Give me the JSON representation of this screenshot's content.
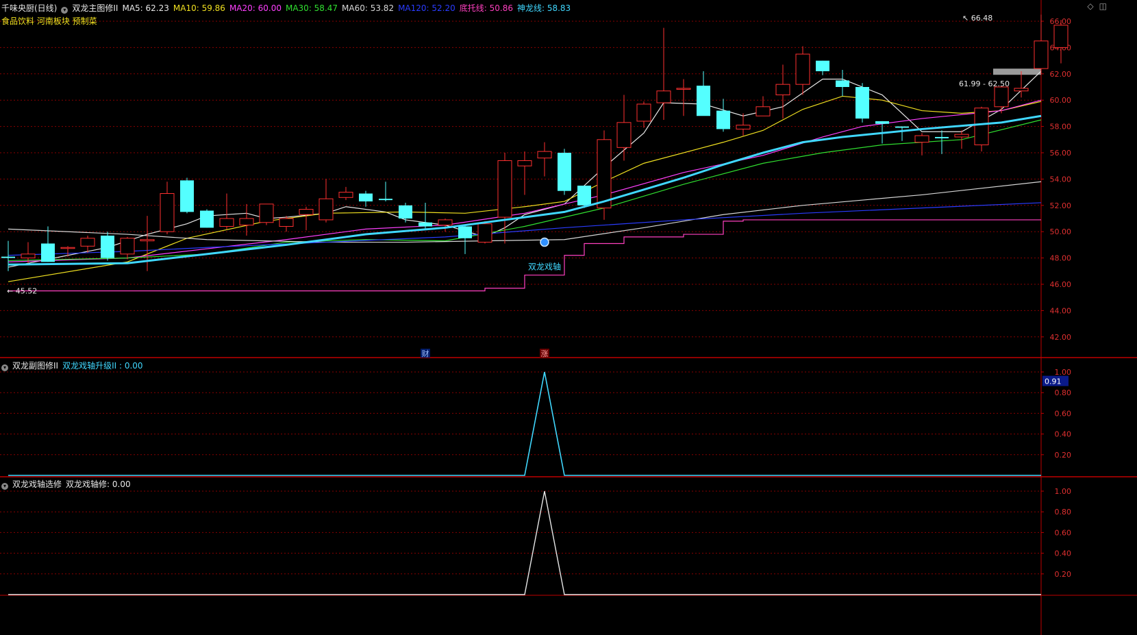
{
  "header": {
    "title": "千味央厨(日线)",
    "indicator": "双龙主图修II",
    "ma": [
      {
        "label": "MA5: 62.23",
        "color": "#e8e8e8"
      },
      {
        "label": "MA10: 59.86",
        "color": "#f0e020"
      },
      {
        "label": "MA20: 60.00",
        "color": "#ff40ff"
      },
      {
        "label": "MA30: 58.47",
        "color": "#30e030"
      },
      {
        "label": "MA60: 53.82",
        "color": "#d8d8d8"
      },
      {
        "label": "MA120: 52.20",
        "color": "#2a3cff"
      },
      {
        "label": "底托线: 50.86",
        "color": "#ff40c0"
      },
      {
        "label": "神龙线: 58.83",
        "color": "#40d8ff"
      }
    ],
    "tags": "食品饮料 河南板块 预制菜"
  },
  "panel2": {
    "title": "双龙副图修II",
    "label": "双龙戏轴升级II : 0.00",
    "current": "0.91"
  },
  "panel3": {
    "title": "双龙戏轴选修",
    "label": "双龙戏轴修: 0.00"
  },
  "markers": {
    "cai": "财",
    "zhang": "涨"
  },
  "colors": {
    "up": "#ff3030",
    "down": "#54ffff",
    "grid": "#8b0000",
    "axis": "#c00000"
  },
  "chart_data": [
    {
      "type": "candlestick",
      "title": "千味央厨(日线)",
      "ylim": [
        40.8,
        67.0
      ],
      "yticks": [
        "66.00",
        "64.00",
        "62.00",
        "60.00",
        "58.00",
        "56.00",
        "54.00",
        "52.00",
        "50.00",
        "48.00",
        "46.00",
        "44.00",
        "42.00"
      ],
      "candles": [
        [
          48.1,
          49.3,
          47.0,
          48.0
        ],
        [
          48.0,
          49.2,
          47.6,
          48.3
        ],
        [
          49.1,
          50.4,
          47.7,
          47.7
        ],
        [
          48.8,
          48.9,
          48.1,
          48.8
        ],
        [
          48.9,
          49.7,
          48.4,
          49.5
        ],
        [
          49.7,
          50.0,
          47.8,
          48.0
        ],
        [
          48.3,
          49.6,
          47.9,
          49.5
        ],
        [
          49.3,
          51.2,
          47.0,
          49.4
        ],
        [
          50.0,
          53.8,
          49.8,
          52.9
        ],
        [
          53.9,
          54.1,
          51.4,
          51.5
        ],
        [
          51.6,
          51.7,
          50.3,
          50.3
        ],
        [
          50.4,
          52.9,
          50.2,
          51.0
        ],
        [
          50.5,
          52.1,
          49.7,
          51.0
        ],
        [
          50.7,
          52.1,
          50.5,
          52.1
        ],
        [
          50.4,
          51.2,
          50.0,
          51.0
        ],
        [
          51.3,
          51.9,
          50.1,
          51.7
        ],
        [
          50.9,
          54.0,
          50.7,
          52.5
        ],
        [
          52.6,
          53.4,
          52.4,
          53.0
        ],
        [
          52.9,
          53.1,
          51.9,
          52.3
        ],
        [
          52.5,
          53.8,
          52.3,
          52.4
        ],
        [
          52.0,
          52.2,
          50.7,
          51.0
        ],
        [
          50.7,
          52.2,
          50.2,
          50.4
        ],
        [
          50.5,
          51.0,
          50.0,
          50.9
        ],
        [
          50.4,
          50.5,
          48.3,
          49.5
        ],
        [
          49.2,
          50.8,
          49.1,
          50.6
        ],
        [
          51.1,
          56.0,
          49.1,
          55.4
        ],
        [
          55.0,
          56.1,
          52.8,
          55.4
        ],
        [
          55.6,
          56.8,
          54.2,
          56.1
        ],
        [
          56.0,
          56.3,
          52.8,
          53.1
        ],
        [
          53.5,
          53.5,
          51.8,
          52.0
        ],
        [
          51.8,
          57.7,
          50.9,
          57.0
        ],
        [
          56.4,
          60.4,
          55.4,
          58.3
        ],
        [
          58.4,
          59.9,
          57.9,
          59.7
        ],
        [
          59.8,
          65.5,
          58.5,
          60.7
        ],
        [
          60.9,
          61.6,
          58.8,
          60.9
        ],
        [
          61.1,
          62.2,
          59.7,
          58.8
        ],
        [
          59.2,
          60.1,
          57.6,
          57.8
        ],
        [
          57.8,
          59.0,
          57.3,
          58.1
        ],
        [
          58.8,
          60.3,
          58.8,
          59.5
        ],
        [
          60.4,
          62.7,
          58.6,
          61.2
        ],
        [
          61.2,
          64.1,
          60.4,
          63.5
        ],
        [
          63.0,
          63.0,
          61.9,
          62.2
        ],
        [
          61.5,
          62.3,
          60.3,
          61.0
        ],
        [
          61.0,
          61.3,
          58.3,
          58.6
        ],
        [
          58.4,
          58.4,
          56.7,
          58.2
        ],
        [
          58.0,
          58.0,
          56.9,
          57.9
        ],
        [
          56.8,
          57.5,
          55.8,
          57.3
        ],
        [
          57.2,
          57.7,
          55.9,
          57.1
        ],
        [
          57.2,
          57.7,
          56.3,
          57.4
        ],
        [
          56.6,
          59.5,
          56.1,
          59.4
        ],
        [
          59.5,
          61.1,
          59.0,
          61.0
        ],
        [
          60.7,
          62.2,
          60.2,
          60.9
        ],
        [
          62.4,
          66.5,
          62.0,
          64.5
        ],
        [
          64.0,
          66.1,
          62.8,
          65.7
        ]
      ],
      "lines": [
        {
          "name": "MA5",
          "color": "#e8e8e8",
          "points": [
            [
              0,
              47.3
            ],
            [
              5,
              48.8
            ],
            [
              7,
              49.8
            ],
            [
              9,
              50.6
            ],
            [
              10,
              51.2
            ],
            [
              12,
              51.4
            ],
            [
              13,
              51.0
            ],
            [
              14,
              51.1
            ],
            [
              16,
              51.4
            ],
            [
              17,
              51.9
            ],
            [
              19,
              51.5
            ],
            [
              20,
              50.9
            ],
            [
              22,
              50.5
            ],
            [
              24,
              49.6
            ],
            [
              25,
              50.3
            ],
            [
              26,
              51.3
            ],
            [
              28,
              52.1
            ],
            [
              30,
              54.9
            ],
            [
              32,
              57.5
            ],
            [
              33,
              59.8
            ],
            [
              35,
              59.7
            ],
            [
              37,
              58.8
            ],
            [
              39,
              59.5
            ],
            [
              41,
              61.6
            ],
            [
              42,
              61.6
            ],
            [
              44,
              60.4
            ],
            [
              46,
              57.6
            ],
            [
              48,
              57.6
            ],
            [
              50,
              59.3
            ],
            [
              52,
              62.2
            ]
          ]
        },
        {
          "name": "MA10",
          "color": "#f0e020",
          "points": [
            [
              0,
              46.2
            ],
            [
              6,
              47.7
            ],
            [
              9,
              49.5
            ],
            [
              13,
              50.8
            ],
            [
              16,
              51.4
            ],
            [
              20,
              51.5
            ],
            [
              23,
              51.4
            ],
            [
              26,
              51.9
            ],
            [
              28,
              52.3
            ],
            [
              30,
              53.8
            ],
            [
              32,
              55.2
            ],
            [
              36,
              56.8
            ],
            [
              38,
              57.7
            ],
            [
              40,
              59.3
            ],
            [
              42,
              60.3
            ],
            [
              44,
              60.0
            ],
            [
              46,
              59.2
            ],
            [
              48,
              59.0
            ],
            [
              50,
              59.2
            ],
            [
              52,
              59.9
            ]
          ]
        },
        {
          "name": "MA20",
          "color": "#ff40ff",
          "points": [
            [
              0,
              47.7
            ],
            [
              6,
              48.0
            ],
            [
              10,
              48.7
            ],
            [
              14,
              49.4
            ],
            [
              18,
              50.2
            ],
            [
              22,
              50.5
            ],
            [
              26,
              51.4
            ],
            [
              30,
              52.8
            ],
            [
              34,
              54.5
            ],
            [
              38,
              55.8
            ],
            [
              41,
              57.2
            ],
            [
              43,
              58.0
            ],
            [
              46,
              58.6
            ],
            [
              50,
              59.2
            ],
            [
              52,
              60.0
            ]
          ]
        },
        {
          "name": "MA30",
          "color": "#30e030",
          "points": [
            [
              0,
              47.8
            ],
            [
              6,
              48.0
            ],
            [
              10,
              48.3
            ],
            [
              14,
              49.2
            ],
            [
              18,
              49.4
            ],
            [
              22,
              49.3
            ],
            [
              26,
              50.4
            ],
            [
              30,
              51.8
            ],
            [
              34,
              53.6
            ],
            [
              38,
              55.2
            ],
            [
              41,
              56.0
            ],
            [
              44,
              56.6
            ],
            [
              48,
              57.0
            ],
            [
              52,
              58.5
            ]
          ]
        },
        {
          "name": "MA60",
          "color": "#d8d8d8",
          "points": [
            [
              0,
              50.2
            ],
            [
              6,
              49.8
            ],
            [
              10,
              49.4
            ],
            [
              16,
              49.2
            ],
            [
              20,
              49.2
            ],
            [
              24,
              49.3
            ],
            [
              28,
              49.4
            ],
            [
              32,
              50.3
            ],
            [
              36,
              51.3
            ],
            [
              40,
              52.0
            ],
            [
              46,
              52.8
            ],
            [
              52,
              53.8
            ]
          ]
        },
        {
          "name": "MA120",
          "color": "#2a3cff",
          "points": [
            [
              0,
              48.2
            ],
            [
              6,
              48.5
            ],
            [
              10,
              48.8
            ],
            [
              16,
              49.2
            ],
            [
              22,
              49.6
            ],
            [
              28,
              50.3
            ],
            [
              34,
              50.9
            ],
            [
              40,
              51.4
            ],
            [
              46,
              51.8
            ],
            [
              52,
              52.2
            ]
          ]
        },
        {
          "name": "底托线",
          "color": "#ff40c0",
          "step": true,
          "points": [
            [
              0,
              45.5
            ],
            [
              23,
              45.5
            ],
            [
              24,
              45.7
            ],
            [
              25,
              45.7
            ],
            [
              26,
              46.7
            ],
            [
              27,
              46.7
            ],
            [
              28,
              48.2
            ],
            [
              29,
              49.1
            ],
            [
              30,
              49.1
            ],
            [
              31,
              49.6
            ],
            [
              33,
              49.6
            ],
            [
              34,
              49.8
            ],
            [
              35,
              49.8
            ],
            [
              36,
              50.8
            ],
            [
              37,
              50.9
            ],
            [
              52,
              50.9
            ]
          ]
        },
        {
          "name": "神龙线",
          "color": "#40d8ff",
          "width": 3,
          "points": [
            [
              0,
              47.5
            ],
            [
              6,
              47.6
            ],
            [
              10,
              48.3
            ],
            [
              14,
              49.0
            ],
            [
              18,
              49.8
            ],
            [
              22,
              50.3
            ],
            [
              26,
              51.1
            ],
            [
              28,
              51.5
            ],
            [
              30,
              52.3
            ],
            [
              32,
              53.2
            ],
            [
              34,
              54.1
            ],
            [
              36,
              55.1
            ],
            [
              38,
              56.0
            ],
            [
              40,
              56.8
            ],
            [
              42,
              57.2
            ],
            [
              46,
              57.8
            ],
            [
              50,
              58.3
            ],
            [
              52,
              58.8
            ]
          ]
        }
      ],
      "annotations": {
        "high": "66.48",
        "low": "45.52",
        "range": "61.99 - 62.50",
        "signal": "双龙戏轴",
        "signal_index": 27
      }
    },
    {
      "type": "line",
      "title": "双龙副图修II",
      "ylim": [
        0.0,
        1.1
      ],
      "yticks": [
        "1.00",
        "0.80",
        "0.60",
        "0.40",
        "0.20"
      ],
      "series": [
        {
          "name": "双龙戏轴升级II",
          "color": "#40d8ff",
          "points": [
            [
              0,
              0
            ],
            [
              26,
              0
            ],
            [
              27,
              1
            ],
            [
              28,
              0
            ],
            [
              52,
              0
            ]
          ]
        }
      ]
    },
    {
      "type": "line",
      "title": "双龙戏轴选修",
      "ylim": [
        0.0,
        1.1
      ],
      "yticks": [
        "1.00",
        "0.80",
        "0.60",
        "0.40",
        "0.20"
      ],
      "series": [
        {
          "name": "双龙戏轴修",
          "color": "#e8e8e8",
          "points": [
            [
              0,
              0
            ],
            [
              26,
              0
            ],
            [
              27,
              1
            ],
            [
              28,
              0
            ],
            [
              52,
              0
            ]
          ]
        }
      ]
    }
  ]
}
